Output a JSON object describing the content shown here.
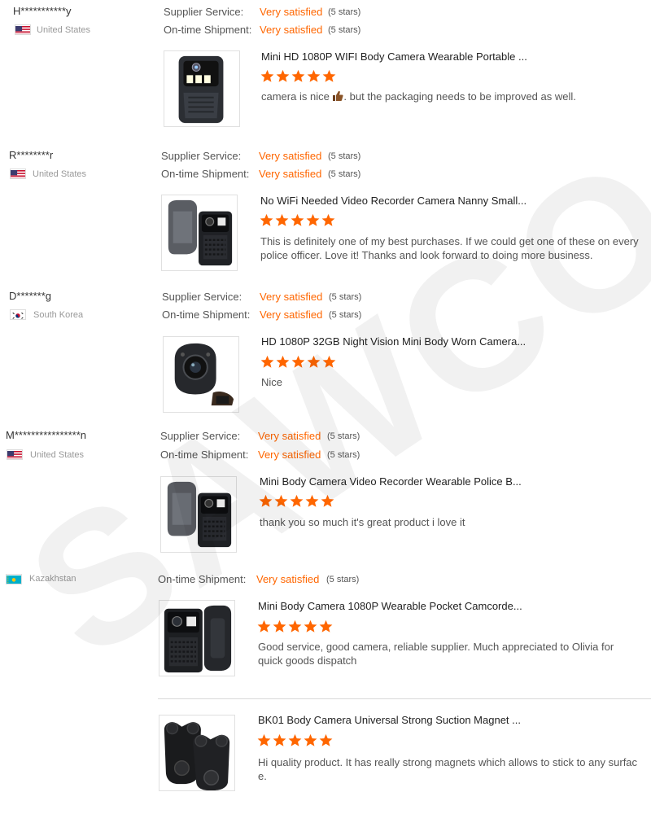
{
  "labels": {
    "supplier_service": "Supplier Service:",
    "ontime_shipment": "On-time Shipment:"
  },
  "colors": {
    "rating_accent": "#ff6600",
    "star": "#ff6600",
    "text_muted": "#999999"
  },
  "reviews": [
    {
      "buyer": "H***********y",
      "country": "United States",
      "flag_icon": "us-flag-icon",
      "supplier_service": {
        "value": "Very satisfied",
        "stars": "(5 stars)"
      },
      "ontime_shipment": {
        "value": "Very satisfied",
        "stars": "(5 stars)"
      },
      "product_title": "Mini HD 1080P WIFI Body Camera Wearable Portable ...",
      "product_icon": "body-camera-icon",
      "rating": 5,
      "comment_before": "camera is nice ",
      "comment_emoji": "thumbs-up-icon",
      "comment_after": ". but the packaging needs to be improved as well."
    },
    {
      "buyer": "R********r",
      "country": "United States",
      "flag_icon": "us-flag-icon",
      "supplier_service": {
        "value": "Very satisfied",
        "stars": "(5 stars)"
      },
      "ontime_shipment": {
        "value": "Very satisfied",
        "stars": "(5 stars)"
      },
      "product_title": "No WiFi Needed Video Recorder Camera Nanny Small...",
      "product_icon": "camera-with-clip-icon",
      "rating": 5,
      "comment": "This is definitely one of my best purchases. If we could get one of these on every police officer. Love it! Thanks and look forward to doing more business."
    },
    {
      "buyer": "D*******g",
      "country": "South Korea",
      "flag_icon": "kr-flag-icon",
      "supplier_service": {
        "value": "Very satisfied",
        "stars": "(5 stars)"
      },
      "ontime_shipment": {
        "value": "Very satisfied",
        "stars": "(5 stars)"
      },
      "product_title": "HD 1080P 32GB Night Vision Mini Body Worn Camera...",
      "product_icon": "mini-round-camera-icon",
      "rating": 5,
      "comment": "Nice"
    },
    {
      "buyer": "M****************n",
      "country": "United States",
      "flag_icon": "us-flag-icon",
      "supplier_service": {
        "value": "Very satisfied",
        "stars": "(5 stars)"
      },
      "ontime_shipment": {
        "value": "Very satisfied",
        "stars": "(5 stars)"
      },
      "product_title": "Mini Body Camera Video Recorder Wearable Police B...",
      "product_icon": "camera-with-clip-icon",
      "rating": 5,
      "comment": "thank you so much it's great product i love it"
    },
    {
      "buyer": "",
      "country": "Kazakhstan",
      "flag_icon": "kz-flag-icon",
      "ontime_shipment": {
        "value": "Very satisfied",
        "stars": "(5 stars)"
      },
      "products": [
        {
          "product_title": "Mini Body Camera 1080P Wearable Pocket Camcorde...",
          "product_icon": "pocket-camcorder-icon",
          "rating": 5,
          "comment": "Good service, good camera, reliable supplier. Much appreciated to Olivia for quick goods dispatch"
        },
        {
          "product_title": "BK01 Body Camera Universal Strong Suction Magnet ...",
          "product_icon": "magnet-mount-icon",
          "rating": 5,
          "comment": "Hi quality product. It has really strong magnets which allows to stick to any surfac e."
        }
      ]
    }
  ]
}
